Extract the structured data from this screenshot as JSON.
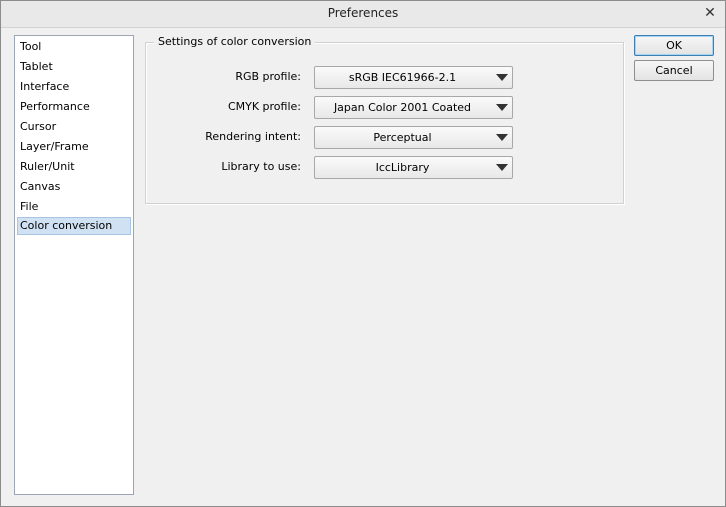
{
  "window": {
    "title": "Preferences",
    "close_glyph": "✕"
  },
  "sidebar": {
    "items": [
      {
        "label": "Tool"
      },
      {
        "label": "Tablet"
      },
      {
        "label": "Interface"
      },
      {
        "label": "Performance"
      },
      {
        "label": "Cursor"
      },
      {
        "label": "Layer/Frame"
      },
      {
        "label": "Ruler/Unit"
      },
      {
        "label": "Canvas"
      },
      {
        "label": "File"
      },
      {
        "label": "Color conversion",
        "selected": true
      }
    ]
  },
  "settings": {
    "group_title": "Settings of color conversion",
    "rows": [
      {
        "label": "RGB profile:",
        "value": "sRGB IEC61966-2.1"
      },
      {
        "label": "CMYK profile:",
        "value": "Japan Color 2001 Coated"
      },
      {
        "label": "Rendering intent:",
        "value": "Perceptual"
      },
      {
        "label": "Library to use:",
        "value": "IccLibrary"
      }
    ]
  },
  "buttons": {
    "ok_label": "OK",
    "cancel_label": "Cancel"
  },
  "colors": {
    "selection_bg": "#cfe1f3",
    "default_button_border": "#3c7fb1"
  },
  "icons": {
    "close": "close-icon",
    "dropdown": "chevron-down-icon"
  }
}
